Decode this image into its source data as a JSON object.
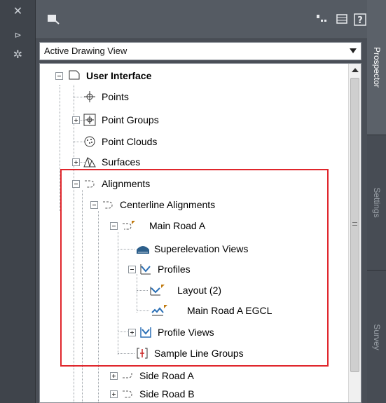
{
  "strip": {
    "close_glyph": "✕",
    "pin_glyph": "⊳",
    "props_glyph": "✲"
  },
  "view_select": {
    "value": "Active Drawing View"
  },
  "tree": {
    "root": "User Interface",
    "points": "Points",
    "point_groups": "Point Groups",
    "point_clouds": "Point Clouds",
    "surfaces": "Surfaces",
    "alignments": "Alignments",
    "centerline_alignments": "Centerline Alignments",
    "main_road_a": "Main Road A",
    "superelevation_views": "Superelevation Views",
    "profiles": "Profiles",
    "layout": "Layout (2)",
    "main_road_a_egcl": "Main Road A EGCL",
    "profile_views": "Profile Views",
    "sample_line_groups": "Sample Line Groups",
    "side_road_a": "Side Road A",
    "side_road_b": "Side Road B"
  },
  "tabs": {
    "prospector": "Prospector",
    "settings": "Settings",
    "survey": "Survey"
  },
  "colors": {
    "highlight": "#e0262c",
    "panel_bg": "#4a4f57",
    "active_tab": "#ffffff"
  }
}
